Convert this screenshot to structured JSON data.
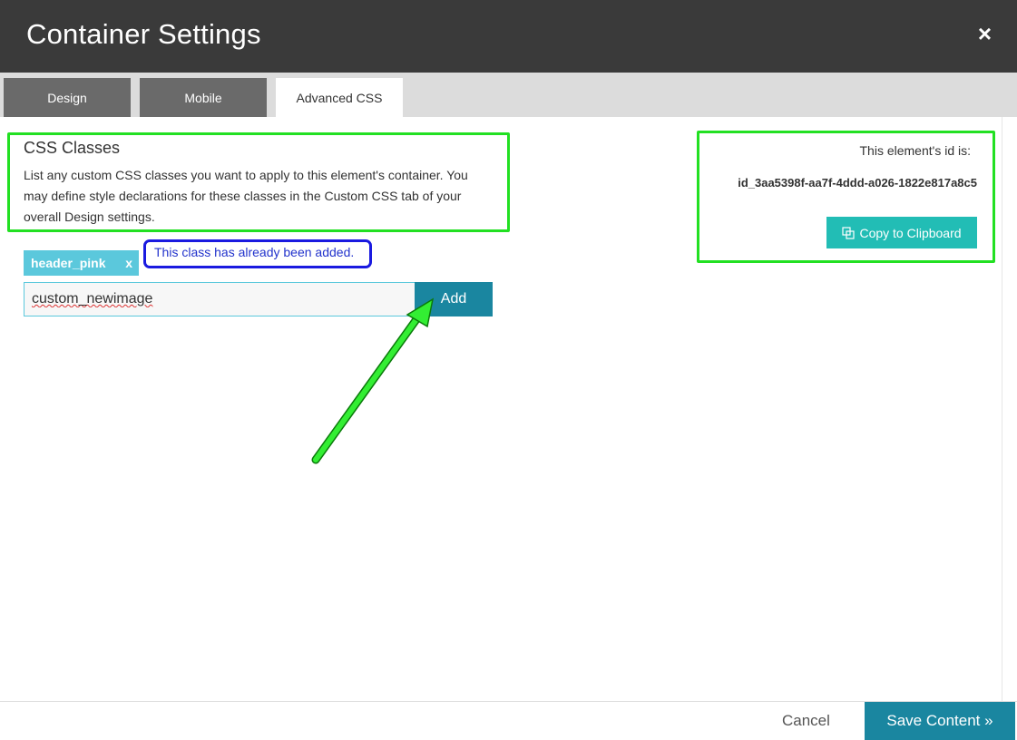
{
  "dialog": {
    "title": "Container Settings",
    "close_glyph": "×"
  },
  "tabs": [
    {
      "label": "Design",
      "active": false
    },
    {
      "label": "Mobile",
      "active": false
    },
    {
      "label": "Advanced CSS",
      "active": true
    }
  ],
  "css_classes": {
    "heading": "CSS Classes",
    "description": "List any custom CSS classes you want to apply to this element's container. You may define style declarations for these classes in the Custom CSS tab of your overall Design settings.",
    "tags": [
      {
        "label": "header_pink",
        "remove_glyph": "x"
      }
    ],
    "notice": "This class has already been added.",
    "input_value": "custom_newimage",
    "add_label": "Add"
  },
  "element_id": {
    "label": "This element's id is:",
    "value": "id_3aa5398f-aa7f-4ddd-a026-1822e817a8c5",
    "copy_label": "Copy to Clipboard"
  },
  "footer": {
    "cancel_label": "Cancel",
    "save_label": "Save Content »"
  },
  "colors": {
    "titlebar": "#3a3a3a",
    "accent": "#1a86a0",
    "tag": "#5bc8dc",
    "copy_button": "#22bdb5",
    "annotation_green": "#22e022",
    "annotation_blue": "#1a1ae0"
  },
  "icons": [
    "close-icon",
    "copy-icon",
    "annotation-arrow"
  ]
}
